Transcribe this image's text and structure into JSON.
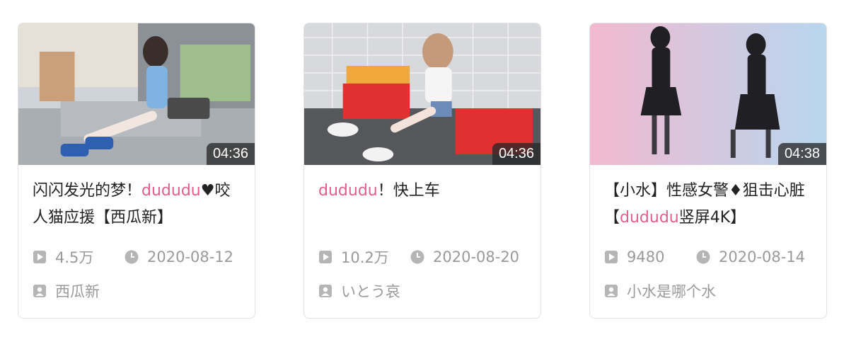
{
  "cards": [
    {
      "title_parts": [
        "闪闪发光的梦！",
        "dududu",
        "♥咬人猫应援【西瓜新】"
      ],
      "duration": "04:36",
      "views": "4.5万",
      "date": "2020-08-12",
      "author": "西瓜新"
    },
    {
      "title_parts": [
        "",
        "dududu",
        "！快上车"
      ],
      "duration": "04:36",
      "views": "10.2万",
      "date": "2020-08-20",
      "author": "いとう哀"
    },
    {
      "title_parts": [
        "【小水】性感女警♦狙击心脏【",
        "dududu",
        "竖屏4K】"
      ],
      "duration": "04:38",
      "views": "9480",
      "date": "2020-08-14",
      "author": "小水是哪个水"
    }
  ],
  "colors": {
    "highlight": "#e0608a",
    "meta_text": "#9a9a9a",
    "icon": "#b5b5b5"
  }
}
